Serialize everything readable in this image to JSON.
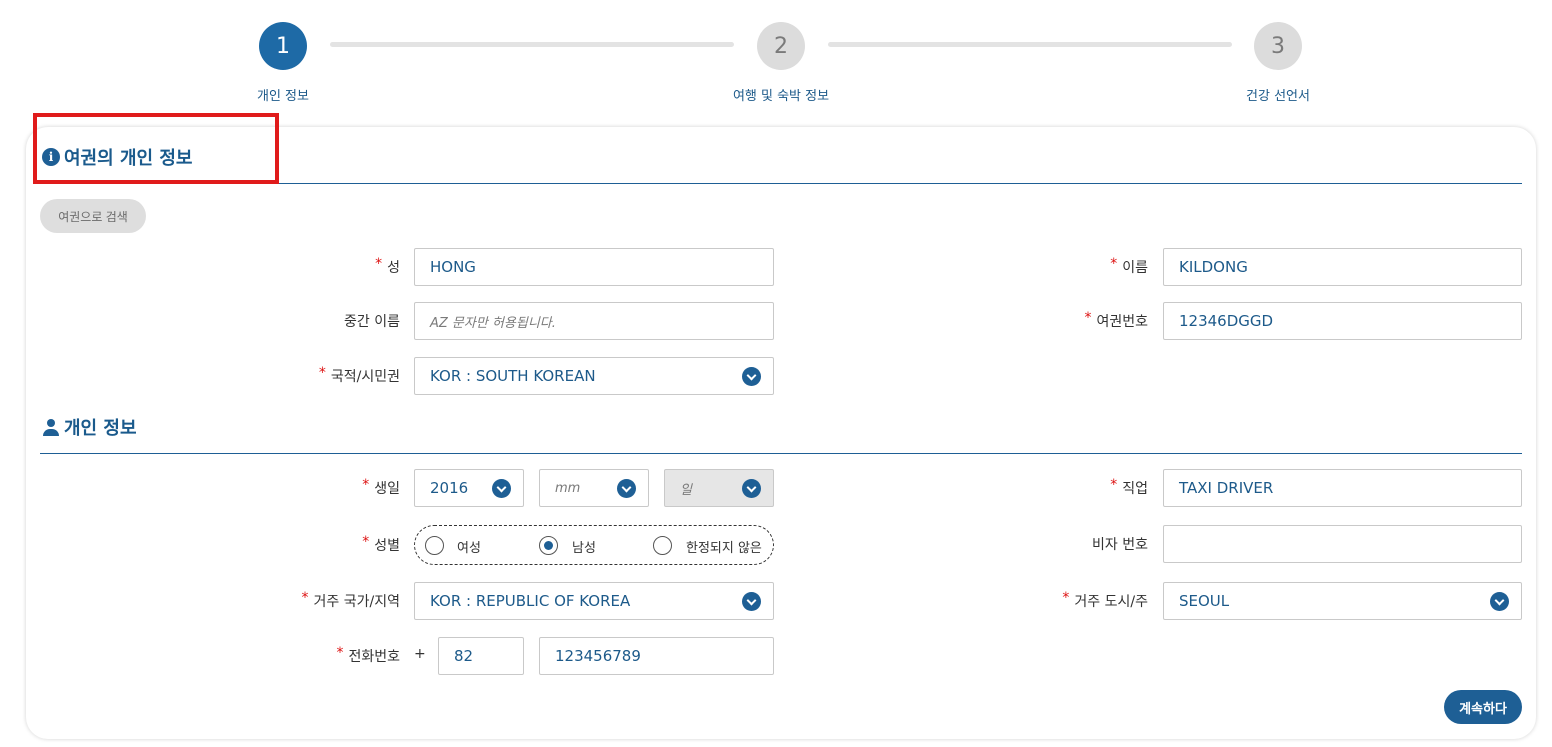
{
  "stepper": {
    "steps": [
      {
        "number": "1",
        "label": "개인 정보"
      },
      {
        "number": "2",
        "label": "여행 및 숙박 정보"
      },
      {
        "number": "3",
        "label": "건강 선언서"
      }
    ]
  },
  "passport_section": {
    "title": "여권의 개인 정보",
    "icon": "info-icon",
    "search_button": "여권으로 검색",
    "surname": {
      "label": "성",
      "value": "HONG",
      "required": true
    },
    "given_name": {
      "label": "이름",
      "value": "KILDONG",
      "required": true
    },
    "middle_name": {
      "label": "중간 이름",
      "placeholder": "AZ 문자만 허용됩니다."
    },
    "passport_number": {
      "label": "여권번호",
      "value": "12346DGGD",
      "required": true
    },
    "nationality": {
      "label": "국적/시민권",
      "value": "KOR : SOUTH KOREAN",
      "required": true
    }
  },
  "personal_section": {
    "title": "개인 정보",
    "icon": "person-icon",
    "birthdate": {
      "label": "생일",
      "year": "2016",
      "month_placeholder": "mm",
      "day_placeholder": "일",
      "required": true
    },
    "occupation": {
      "label": "직업",
      "value": "TAXI DRIVER",
      "required": true
    },
    "gender": {
      "label": "성별",
      "required": true,
      "options": [
        "여성",
        "남성",
        "한정되지 않은"
      ],
      "selected": "남성"
    },
    "visa_number": {
      "label": "비자 번호",
      "value": ""
    },
    "residence_country": {
      "label": "거주 국가/지역",
      "value": "KOR : REPUBLIC OF KOREA",
      "required": true
    },
    "residence_city": {
      "label": "거주 도시/주",
      "value": "SEOUL",
      "required": true
    },
    "phone": {
      "label": "전화번호",
      "plus": "+",
      "country_code": "82",
      "number": "123456789",
      "required": true
    }
  },
  "actions": {
    "continue": "계속하다"
  },
  "required_mark": "*",
  "colors": {
    "primary": "#1e5f95",
    "required": "#dd1111",
    "highlight": "#e01b1b"
  }
}
